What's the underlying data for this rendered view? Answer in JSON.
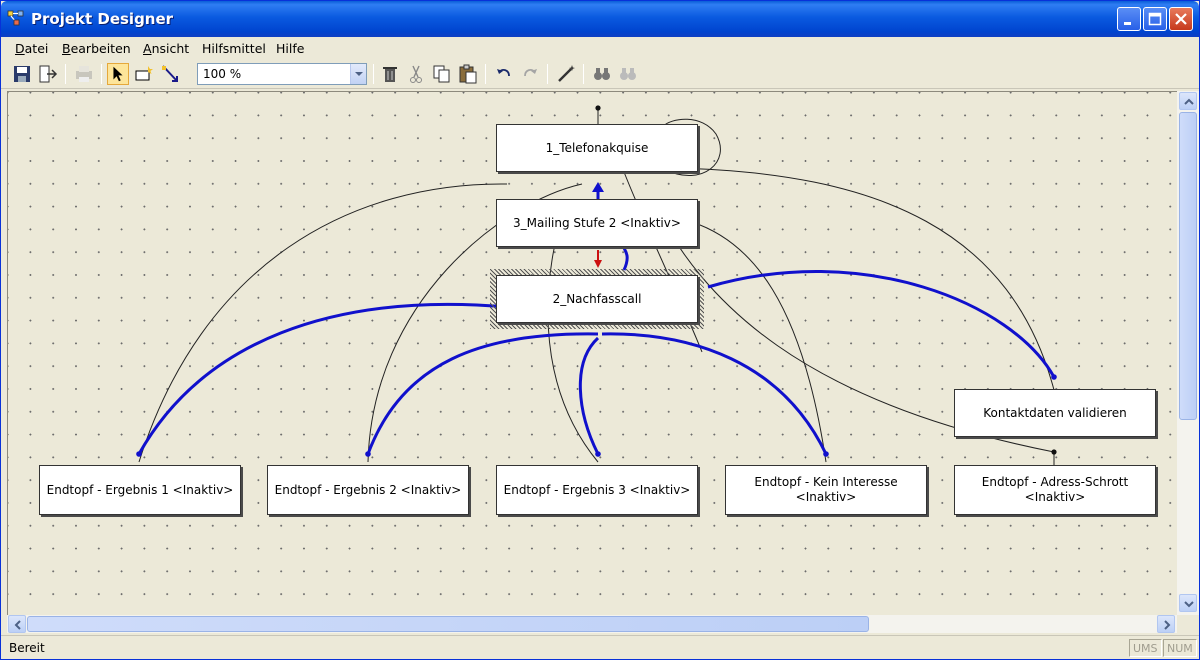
{
  "window": {
    "title": "Projekt Designer"
  },
  "menu": [
    {
      "label": "Datei",
      "u": "D",
      "rest": "atei"
    },
    {
      "label": "Bearbeiten",
      "u": "B",
      "rest": "earbeiten"
    },
    {
      "label": "Ansicht",
      "u": "A",
      "rest": "nsicht"
    },
    {
      "label": "Hilfsmittel",
      "u": "",
      "rest": ""
    },
    {
      "label": "Hilfe",
      "u": "",
      "rest": ""
    }
  ],
  "toolbar": {
    "zoom": "100 %",
    "icons": [
      "save-icon",
      "exit-icon",
      "print-icon",
      "pointer-icon",
      "new-node-icon",
      "connect-icon",
      "delete-icon",
      "cut-icon",
      "copy-icon",
      "paste-icon",
      "undo-icon",
      "redo-icon",
      "magic-wand-icon",
      "find-icon",
      "find-next-icon"
    ]
  },
  "nodes": {
    "telefonakquise": "1_Telefonakquise",
    "mailing": "3_Mailing Stufe 2 <Inaktiv>",
    "nachfasscall": "2_Nachfasscall",
    "kontaktdaten": "Kontaktdaten validieren",
    "ergebnis1": "Endtopf - Ergebnis 1 <Inaktiv>",
    "ergebnis2": "Endtopf - Ergebnis 2 <Inaktiv>",
    "ergebnis3": "Endtopf - Ergebnis 3 <Inaktiv>",
    "kein_interesse": "Endtopf - Kein Interesse\n<Inaktiv>",
    "adress_schrott": "Endtopf - Adress-Schrott\n<Inaktiv>"
  },
  "status": {
    "text": "Bereit",
    "caps": "UMS",
    "num": "NUM"
  },
  "colors": {
    "edge_thin": "#222222",
    "edge_active": "#1010cc",
    "edge_red": "#cc1010",
    "canvas": "#ece9d8"
  }
}
